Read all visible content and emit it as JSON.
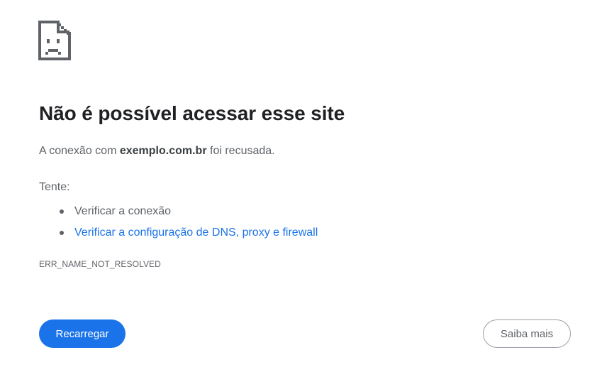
{
  "error_page": {
    "icon": "sad-document-icon",
    "title": "Não é possível acessar esse site",
    "summary": {
      "prefix": "A conexão com ",
      "host": "exemplo.com.br",
      "suffix": " foi recusada."
    },
    "try_label": "Tente:",
    "suggestions": [
      {
        "label": "Verificar a conexão",
        "is_link": false
      },
      {
        "label": "Verificar a configuração de DNS, proxy e firewall",
        "is_link": true
      }
    ],
    "error_code": "ERR_NAME_NOT_RESOLVED"
  },
  "buttons": {
    "reload_label": "Recarregar",
    "learn_more_label": "Saiba mais"
  },
  "colors": {
    "accent": "#1a73e8",
    "title_text": "#202124",
    "body_text": "#5f6368"
  }
}
